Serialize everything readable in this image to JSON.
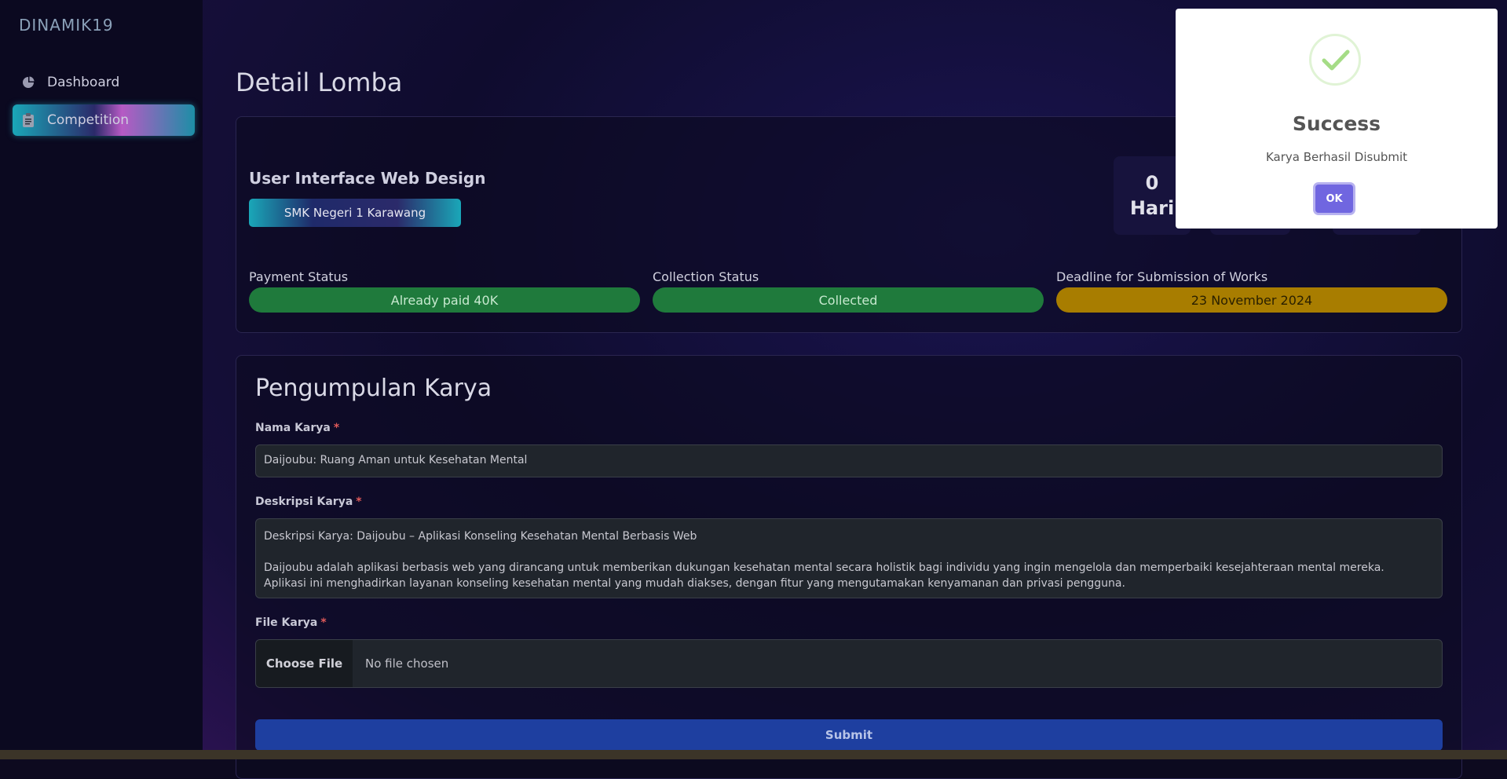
{
  "app": {
    "logo": "DINAMIK19"
  },
  "sidebar": {
    "items": [
      {
        "label": "Dashboard",
        "icon": "pie-chart-icon"
      },
      {
        "label": "Competition",
        "icon": "clipboard-icon"
      }
    ]
  },
  "page": {
    "title": "Detail Lomba"
  },
  "competition": {
    "title": "User Interface Web Design",
    "school": "SMK Negeri 1 Karawang",
    "countdown": [
      {
        "value": "0",
        "unit": "Hari"
      }
    ],
    "payment": {
      "label": "Payment Status",
      "value": "Already paid 40K"
    },
    "collection": {
      "label": "Collection Status",
      "value": "Collected"
    },
    "deadline": {
      "label": "Deadline for Submission of Works",
      "value": "23 November 2024"
    }
  },
  "form": {
    "title": "Pengumpulan Karya",
    "name_label": "Nama Karya",
    "name_value": "Daijoubu: Ruang Aman untuk Kesehatan Mental",
    "desc_label": "Deskripsi Karya",
    "desc_line1": "Deskripsi Karya: Daijoubu – Aplikasi Konseling Kesehatan Mental Berbasis Web",
    "desc_line2": "Daijoubu adalah aplikasi berbasis web yang dirancang untuk memberikan dukungan kesehatan mental secara holistik bagi individu yang ingin mengelola dan memperbaiki kesejahteraan mental mereka.",
    "desc_line3": "Aplikasi ini menghadirkan layanan konseling kesehatan mental yang mudah diakses, dengan fitur yang mengutamakan kenyamanan dan privasi pengguna.",
    "file_label": "File Karya",
    "choose_file": "Choose File",
    "no_file": "No file chosen",
    "submit": "Submit",
    "required_mark": "*"
  },
  "modal": {
    "title": "Success",
    "message": "Karya Berhasil Disubmit",
    "ok": "OK",
    "icon": "check-icon"
  },
  "colors": {
    "paid": "#1f7a3c",
    "deadline": "#a87d00",
    "submit": "#1e3fa0",
    "ok": "#7066e0",
    "success_check": "#a5dc86"
  }
}
